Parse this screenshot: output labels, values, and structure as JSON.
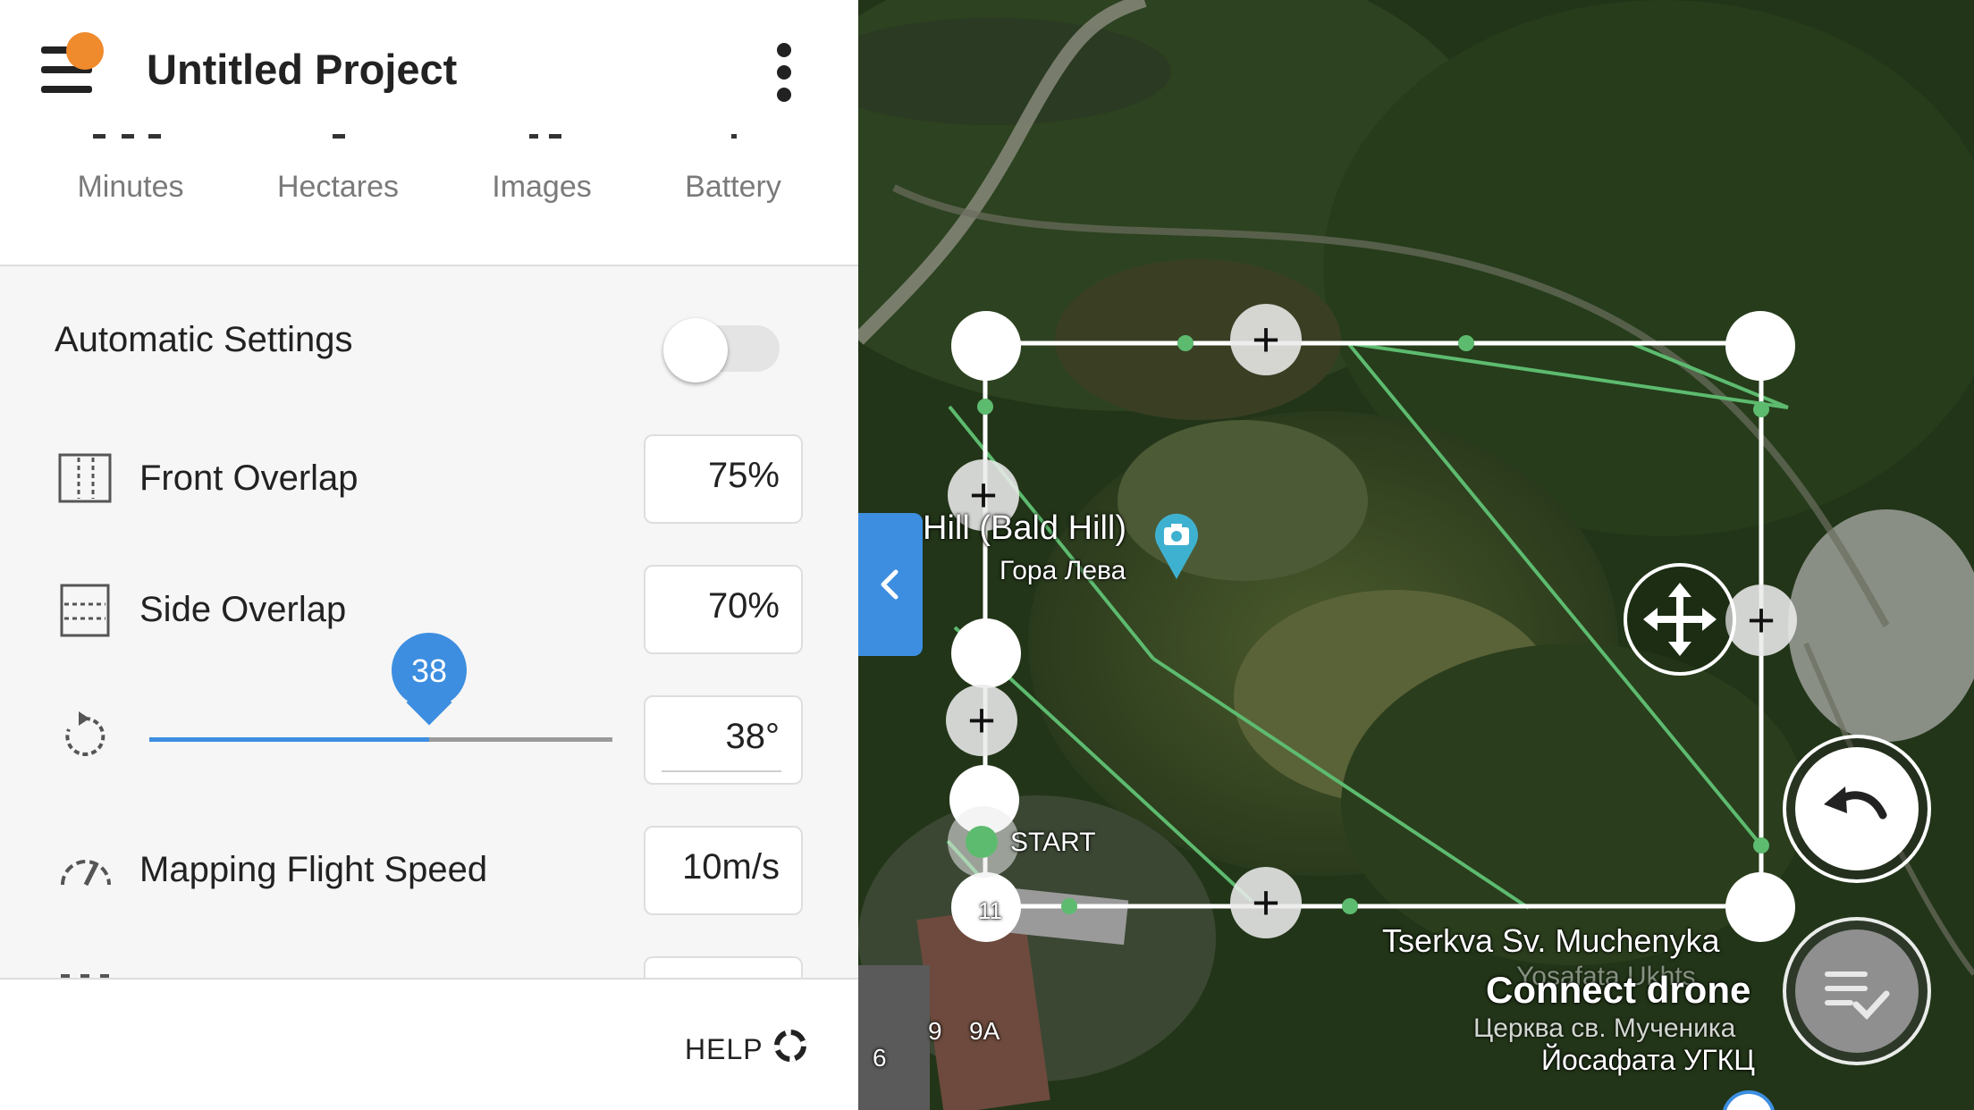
{
  "app": {
    "title": "Untitled Project"
  },
  "stats": [
    {
      "label": "Minutes"
    },
    {
      "label": "Hectares"
    },
    {
      "label": "Images"
    },
    {
      "label": "Battery"
    }
  ],
  "settings": {
    "auto_label": "Automatic Settings",
    "auto_enabled": false,
    "front_overlap": {
      "label": "Front Overlap",
      "value": "75%"
    },
    "side_overlap": {
      "label": "Side Overlap",
      "value": "70%"
    },
    "rotation": {
      "value": "38°",
      "slider_value": 38,
      "slider_label": "38"
    },
    "speed": {
      "label": "Mapping Flight Speed",
      "value": "10m/s"
    }
  },
  "footer": {
    "help_label": "HELP"
  },
  "map": {
    "poi_name": "Hill (Bald Hill)",
    "poi_name_local": "Гора Лева",
    "start_label": "START",
    "church_name": "Tserkva Sv. Muchenyka",
    "church_sub": "Yosafata Ukhts",
    "church_local_1": "Церква св. Мученика",
    "church_local_2": "Йосафата УГКЦ",
    "connect_label": "Connect drone",
    "house_numbers": [
      "9",
      "9A",
      "6",
      "11"
    ],
    "colors": {
      "route": "#5dbb6f",
      "accent": "#3d8ee0",
      "poi": "#3fb1d0"
    }
  }
}
